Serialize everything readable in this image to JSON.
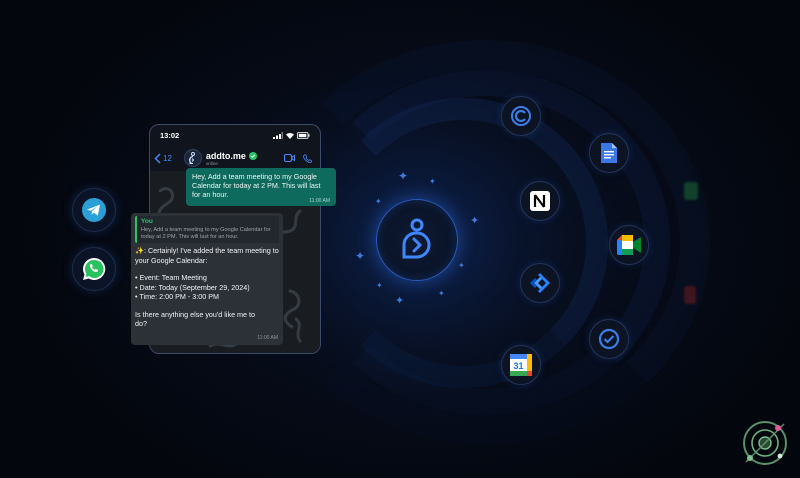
{
  "phone": {
    "time": "13:02",
    "back_count": "12",
    "contact_name": "addto.me",
    "contact_status": "online"
  },
  "outgoing": {
    "text": "Hey, Add a team meeting to my Google Calendar for today at 2 PM. This will last for an hour.",
    "time": "11:00 AM"
  },
  "incoming": {
    "quote_author": "You",
    "quote_text": "Hey, Add a team meeting to my Google Calendar for today at 2 PM. This will last for an hour.",
    "line1": "✨: Certainly! I've added the team meeting to your Google Calendar:",
    "event": "• Event: Team Meeting",
    "date": "• Date: Today (September 29, 2024)",
    "timeRange": "• Time: 2:00 PM - 3:00 PM",
    "question": "Is there anything else you'd like me to do?",
    "time": "11:00 AM"
  },
  "calendar_day": "31",
  "colors": {
    "accent": "#2f7ff0",
    "bubble_out": "#0f6a5e",
    "bubble_in": "#2c3137",
    "background": "#04070e"
  },
  "icons": [
    "telegram-icon",
    "whatsapp-icon",
    "addtome-logo",
    "notion-icon",
    "google-meet-icon",
    "jira-icon",
    "google-docs-icon",
    "google-calendar-icon",
    "circle-check-icon",
    "circle-c-icon"
  ]
}
